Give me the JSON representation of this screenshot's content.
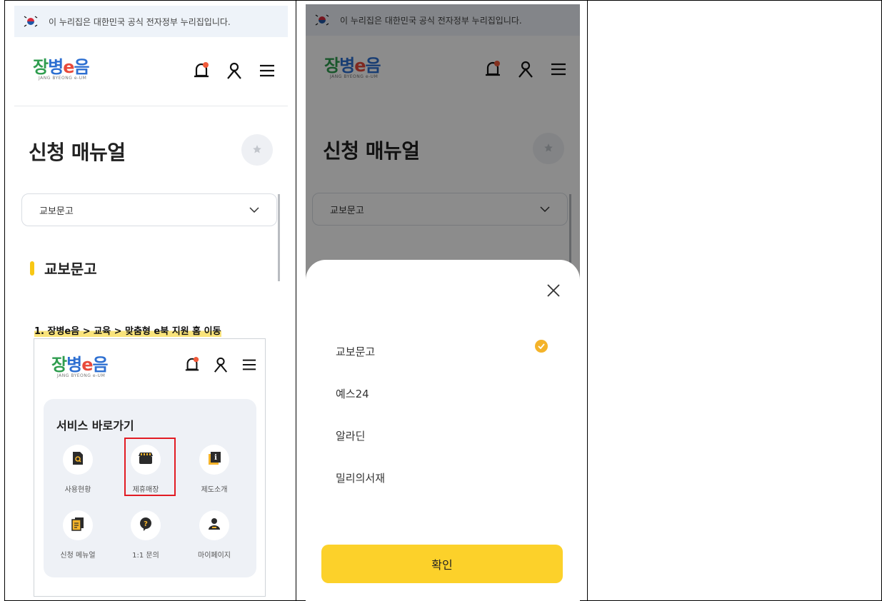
{
  "gov_banner": "이 누리집은 대한민국 공식 전자정부 누리집입니다.",
  "logo": {
    "text": "장병e음",
    "subtitle": "JANG BYEONG e-UM"
  },
  "page_title": "신청 매뉴얼",
  "select": {
    "value": "교보문고"
  },
  "section_title": "교보문고",
  "step1_text": "1. 장병e음 > 교육 > 맞춤형 e북 지원 홈 이동",
  "service_shortcuts": {
    "title": "서비스 바로가기",
    "items": [
      "사용현황",
      "제휴매장",
      "제도소개",
      "신청 메뉴얼",
      "1:1 문의",
      "마이페이지"
    ]
  },
  "dropdown_sheet": {
    "options": [
      "교보문고",
      "예스24",
      "알라딘",
      "밀리의서재"
    ],
    "selected": "교보문고",
    "confirm_label": "확인"
  },
  "colors": {
    "accent_yellow": "#fcd12a",
    "highlight_red": "#e21b23",
    "check_orange": "#f4b32a"
  }
}
